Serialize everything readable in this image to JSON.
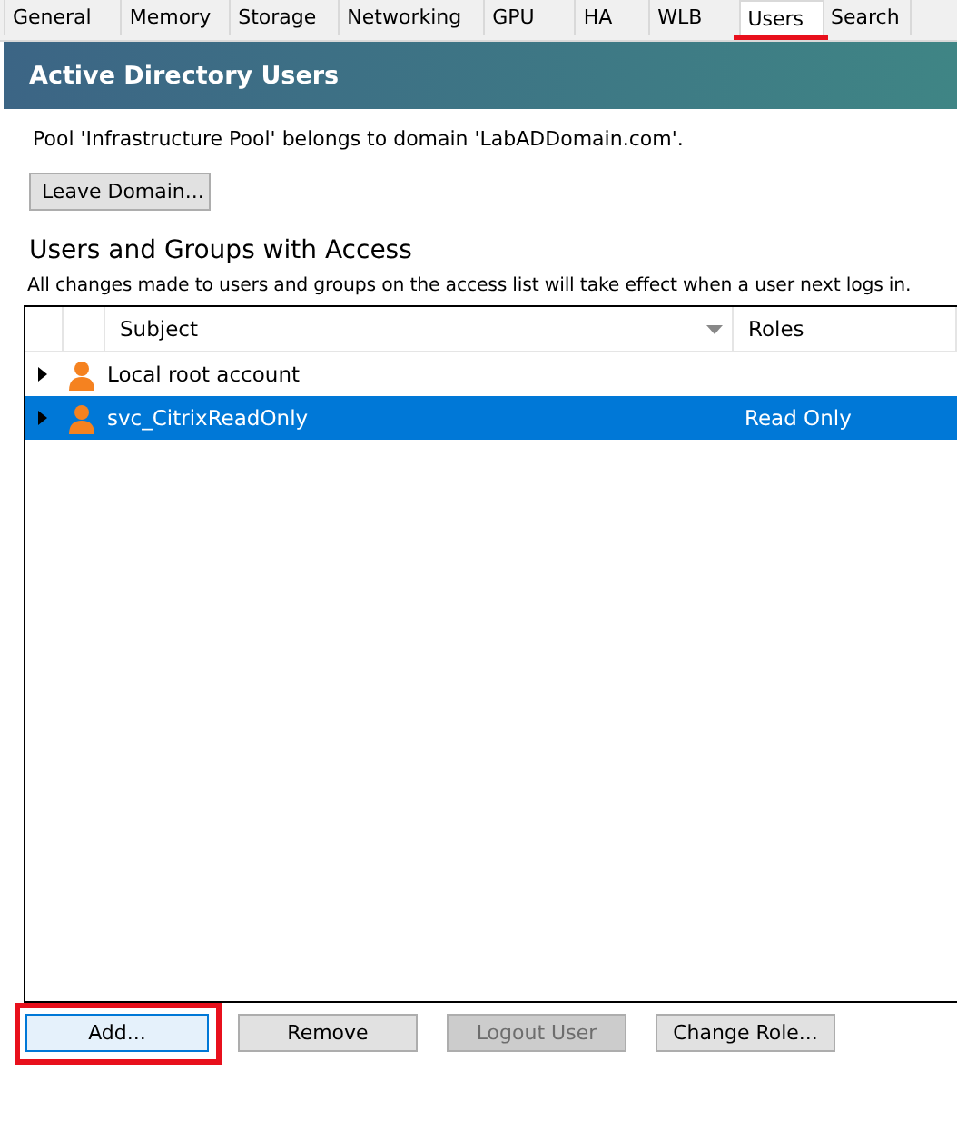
{
  "tabs": [
    {
      "label": "General",
      "selected": false,
      "highlighted": false
    },
    {
      "label": "Memory",
      "selected": false,
      "highlighted": false
    },
    {
      "label": "Storage",
      "selected": false,
      "highlighted": false
    },
    {
      "label": "Networking",
      "selected": false,
      "highlighted": false
    },
    {
      "label": "GPU",
      "selected": false,
      "highlighted": false
    },
    {
      "label": "HA",
      "selected": false,
      "highlighted": false
    },
    {
      "label": "WLB",
      "selected": false,
      "highlighted": false
    },
    {
      "label": "Users",
      "selected": true,
      "highlighted": true
    },
    {
      "label": "Search",
      "selected": false,
      "highlighted": false
    }
  ],
  "header": {
    "title": "Active Directory Users"
  },
  "domain_info": "Pool 'Infrastructure Pool' belongs to domain 'LabADDomain.com'.",
  "leave_domain_button": "Leave Domain...",
  "section_title": "Users and Groups with Access",
  "section_note": "All changes made to users and groups on the access list will take effect when a user next logs in.",
  "table": {
    "columns": [
      "Subject",
      "Roles"
    ],
    "rows": [
      {
        "subject": "Local root account",
        "roles": "",
        "selected": false
      },
      {
        "subject": "svc_CitrixReadOnly",
        "roles": "Read Only",
        "selected": true
      }
    ]
  },
  "buttons": [
    {
      "label": "Add...",
      "disabled": false,
      "focused": true,
      "highlighted": true
    },
    {
      "label": "Remove",
      "disabled": false,
      "focused": false,
      "highlighted": false
    },
    {
      "label": "Logout User",
      "disabled": true,
      "focused": false,
      "highlighted": false
    },
    {
      "label": "Change Role...",
      "disabled": false,
      "focused": false,
      "highlighted": false
    }
  ]
}
